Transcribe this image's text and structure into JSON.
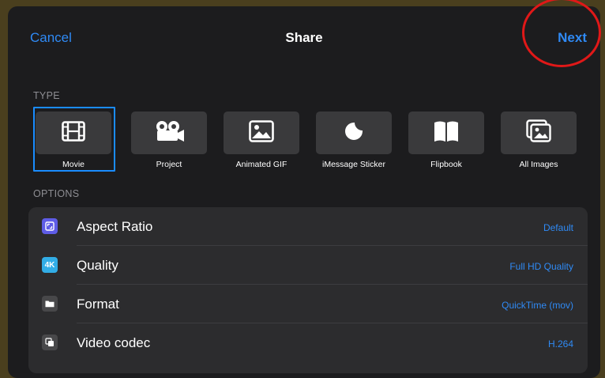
{
  "header": {
    "cancel_label": "Cancel",
    "title": "Share",
    "next_label": "Next"
  },
  "type_section": {
    "heading": "TYPE",
    "selected": "Movie",
    "items": [
      {
        "label": "Movie",
        "icon": "film-icon"
      },
      {
        "label": "Project",
        "icon": "camera-reel-icon"
      },
      {
        "label": "Animated GIF",
        "icon": "image-icon"
      },
      {
        "label": "iMessage Sticker",
        "icon": "sticker-icon"
      },
      {
        "label": "Flipbook",
        "icon": "book-icon"
      },
      {
        "label": "All Images",
        "icon": "photos-stack-icon"
      }
    ]
  },
  "options_section": {
    "heading": "OPTIONS",
    "rows": [
      {
        "label": "Aspect Ratio",
        "value": "Default",
        "icon": "aspect-ratio-icon",
        "icon_color": "#5e5ce6"
      },
      {
        "label": "Quality",
        "value": "Full HD Quality",
        "icon": "quality-4k-icon",
        "icon_text": "4K",
        "icon_color": "#32ade6"
      },
      {
        "label": "Format",
        "value": "QuickTime (mov)",
        "icon": "folder-icon",
        "icon_color": "#48484a"
      },
      {
        "label": "Video codec",
        "value": "H.264",
        "icon": "codec-icon",
        "icon_color": "#48484a"
      }
    ]
  },
  "colors": {
    "accent": "#2f8af5",
    "selection": "#1a8cff",
    "annotation": "#e01818",
    "background": "#1c1c1e",
    "tile": "#3a3a3c"
  }
}
